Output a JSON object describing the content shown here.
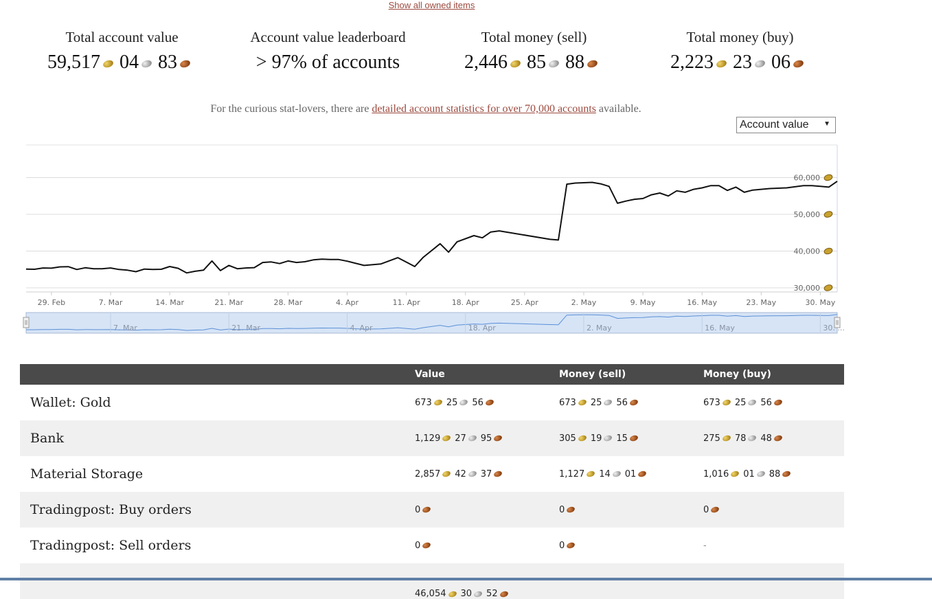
{
  "top_link": "Show all owned items",
  "stats": [
    {
      "label": "Total account value",
      "gold": "59,517",
      "silver": "04",
      "copper": "83"
    },
    {
      "label": "Account value leaderboard",
      "text": "> 97% of accounts"
    },
    {
      "label": "Total money (sell)",
      "gold": "2,446",
      "silver": "85",
      "copper": "88"
    },
    {
      "label": "Total money (buy)",
      "gold": "2,223",
      "silver": "23",
      "copper": "06"
    }
  ],
  "curious": {
    "before": "For the curious stat-lovers, there are ",
    "link": "detailed account statistics for over 70,000 accounts",
    "after": " available."
  },
  "selector": {
    "value": "Account value",
    "arrow": "▼"
  },
  "colors": {
    "accent_link": "#9c4a3f",
    "table_header": "#4a4a4a",
    "navigator_fill": "#d6e4f6",
    "navigator_line": "#5b8fd6"
  },
  "chart_data": {
    "type": "line",
    "x": [
      "2016-02-26",
      "2016-02-27",
      "2016-02-28",
      "2016-02-29",
      "2016-03-01",
      "2016-03-02",
      "2016-03-03",
      "2016-03-04",
      "2016-03-05",
      "2016-03-06",
      "2016-03-07",
      "2016-03-08",
      "2016-03-09",
      "2016-03-10",
      "2016-03-11",
      "2016-03-12",
      "2016-03-13",
      "2016-03-14",
      "2016-03-15",
      "2016-03-16",
      "2016-03-17",
      "2016-03-18",
      "2016-03-19",
      "2016-03-20",
      "2016-03-21",
      "2016-03-22",
      "2016-03-23",
      "2016-03-24",
      "2016-03-25",
      "2016-03-26",
      "2016-03-27",
      "2016-03-28",
      "2016-03-29",
      "2016-03-30",
      "2016-03-31",
      "2016-04-01",
      "2016-04-02",
      "2016-04-03",
      "2016-04-04",
      "2016-04-06",
      "2016-04-08",
      "2016-04-10",
      "2016-04-12",
      "2016-04-13",
      "2016-04-15",
      "2016-04-16",
      "2016-04-17",
      "2016-04-19",
      "2016-04-20",
      "2016-04-21",
      "2016-04-22",
      "2016-04-28",
      "2016-04-29",
      "2016-04-30",
      "2016-05-01",
      "2016-05-02",
      "2016-05-03",
      "2016-05-04",
      "2016-05-05",
      "2016-05-06",
      "2016-05-07",
      "2016-05-08",
      "2016-05-09",
      "2016-05-10",
      "2016-05-11",
      "2016-05-12",
      "2016-05-13",
      "2016-05-14",
      "2016-05-15",
      "2016-05-16",
      "2016-05-17",
      "2016-05-18",
      "2016-05-19",
      "2016-05-20",
      "2016-05-21",
      "2016-05-22",
      "2016-05-24",
      "2016-05-26",
      "2016-05-28",
      "2016-05-29",
      "2016-05-30",
      "2016-05-31",
      "2016-06-01"
    ],
    "series": [
      {
        "values": [
          35100,
          35050,
          35400,
          35350,
          35700,
          35750,
          35000,
          35450,
          35200,
          35200,
          35400,
          35000,
          34800,
          34400,
          35100,
          35000,
          35050,
          35800,
          35300,
          34050,
          34500,
          34800,
          37300,
          34700,
          36100,
          35200,
          35400,
          35500,
          36900,
          37050,
          36600,
          37300,
          36900,
          37100,
          37600,
          37800,
          37700,
          37700,
          37250,
          36100,
          36500,
          38200,
          35800,
          38300,
          42000,
          39700,
          42500,
          44200,
          43600,
          45200,
          45500,
          43200,
          43000,
          58200,
          58500,
          58600,
          58700,
          58300,
          57600,
          53000,
          53600,
          54100,
          54300,
          55300,
          55800,
          55000,
          56400,
          56000,
          56800,
          57200,
          57800,
          57800,
          56500,
          57400,
          56000,
          56600,
          57000,
          57200,
          57800,
          57800,
          57600,
          57400,
          59000,
          59000,
          58600,
          59500
        ]
      }
    ],
    "x_ticks": [
      "29. Feb",
      "7. Mar",
      "14. Mar",
      "21. Mar",
      "28. Mar",
      "4. Apr",
      "11. Apr",
      "18. Apr",
      "25. Apr",
      "2. May",
      "9. May",
      "16. May",
      "23. May",
      "30. May"
    ],
    "y_ticks": [
      "30,000",
      "40,000",
      "50,000",
      "60,000"
    ],
    "ylim": [
      30000,
      70000
    ],
    "navigator_ticks": [
      "7. Mar",
      "21. Mar",
      "4. Apr",
      "18. Apr",
      "2. May",
      "16. May",
      "30. ..."
    ]
  },
  "table": {
    "headers": [
      "",
      "Value",
      "Money (sell)",
      "Money (buy)"
    ],
    "rows": [
      {
        "name": "Wallet: Gold",
        "value": {
          "g": "673",
          "s": "25",
          "c": "56"
        },
        "sell": {
          "g": "673",
          "s": "25",
          "c": "56"
        },
        "buy": {
          "g": "673",
          "s": "25",
          "c": "56"
        }
      },
      {
        "name": "Bank",
        "value": {
          "g": "1,129",
          "s": "27",
          "c": "95"
        },
        "sell": {
          "g": "305",
          "s": "19",
          "c": "15"
        },
        "buy": {
          "g": "275",
          "s": "78",
          "c": "48"
        }
      },
      {
        "name": "Material Storage",
        "value": {
          "g": "2,857",
          "s": "42",
          "c": "37"
        },
        "sell": {
          "g": "1,127",
          "s": "14",
          "c": "01"
        },
        "buy": {
          "g": "1,016",
          "s": "01",
          "c": "88"
        }
      },
      {
        "name": "Tradingpost: Buy orders",
        "value": {
          "c": "0"
        },
        "sell": {
          "c": "0"
        },
        "buy": {
          "c": "0"
        }
      },
      {
        "name": "Tradingpost: Sell orders",
        "value": {
          "c": "0"
        },
        "sell": {
          "c": "0"
        },
        "buy": {
          "text": "-"
        }
      },
      {
        "name": "",
        "value": {
          "g": "46,054",
          "s": "30",
          "c": "52"
        },
        "sell": {},
        "buy": {}
      }
    ]
  }
}
